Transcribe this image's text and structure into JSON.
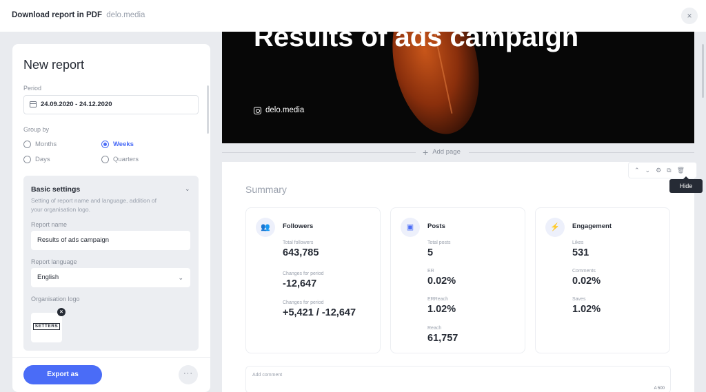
{
  "window": {
    "title": "Download report in PDF",
    "brand": "delo.media",
    "close_icon": "×"
  },
  "left_panel": {
    "heading": "New report",
    "period_label": "Period",
    "period_value": "24.09.2020 - 24.12.2020",
    "group_by_label": "Group by",
    "group_options": [
      {
        "label": "Months",
        "selected": false
      },
      {
        "label": "Weeks",
        "selected": true
      },
      {
        "label": "Days",
        "selected": false
      },
      {
        "label": "Quarters",
        "selected": false
      }
    ],
    "basic_settings": {
      "title": "Basic settings",
      "description": "Setting of report name and language, addition of your organisation logo.",
      "report_name_label": "Report name",
      "report_name_value": "Results of ads campaign",
      "report_language_label": "Report language",
      "report_language_value": "English",
      "org_logo_label": "Organisation logo",
      "logo_text": "SETTERS",
      "remove_icon": "×"
    },
    "export_label": "Export as",
    "more_label": "···"
  },
  "preview": {
    "hero_title": "Results of ads campaign",
    "hero_handle": "delo.media",
    "add_page_label": "Add page",
    "summary_title": "Summary",
    "tooltip": "Hide",
    "toolbar": {
      "up": "⌃",
      "down": "⌄",
      "settings": "⚙",
      "copy": "⧉",
      "delete": "🗑"
    },
    "cards": [
      {
        "title": "Followers",
        "icon": "people-icon",
        "glyph": "👥",
        "metrics": [
          {
            "label": "Total followers",
            "value": "643,785"
          },
          {
            "label": "Changes for period",
            "value": "-12,647"
          },
          {
            "label": "Changes for period",
            "value": "+5,421 / -12,647"
          }
        ]
      },
      {
        "title": "Posts",
        "icon": "image-icon",
        "glyph": "▣",
        "metrics": [
          {
            "label": "Total posts",
            "value": "5"
          },
          {
            "label": "ER",
            "value": "0.02%"
          },
          {
            "label": "ERReach",
            "value": "1.02%"
          },
          {
            "label": "Reach",
            "value": "61,757"
          }
        ]
      },
      {
        "title": "Engagement",
        "icon": "bolt-icon",
        "glyph": "⚡",
        "metrics": [
          {
            "label": "Likes",
            "value": "531"
          },
          {
            "label": "Comments",
            "value": "0.02%"
          },
          {
            "label": "Saves",
            "value": "1.02%"
          }
        ]
      }
    ],
    "comment_placeholder": "Add comment",
    "comment_counter": "A 500"
  },
  "colors": {
    "accent": "#4a6cf7",
    "text": "#262b35",
    "muted": "#8a909b",
    "background": "#e9ebef"
  }
}
